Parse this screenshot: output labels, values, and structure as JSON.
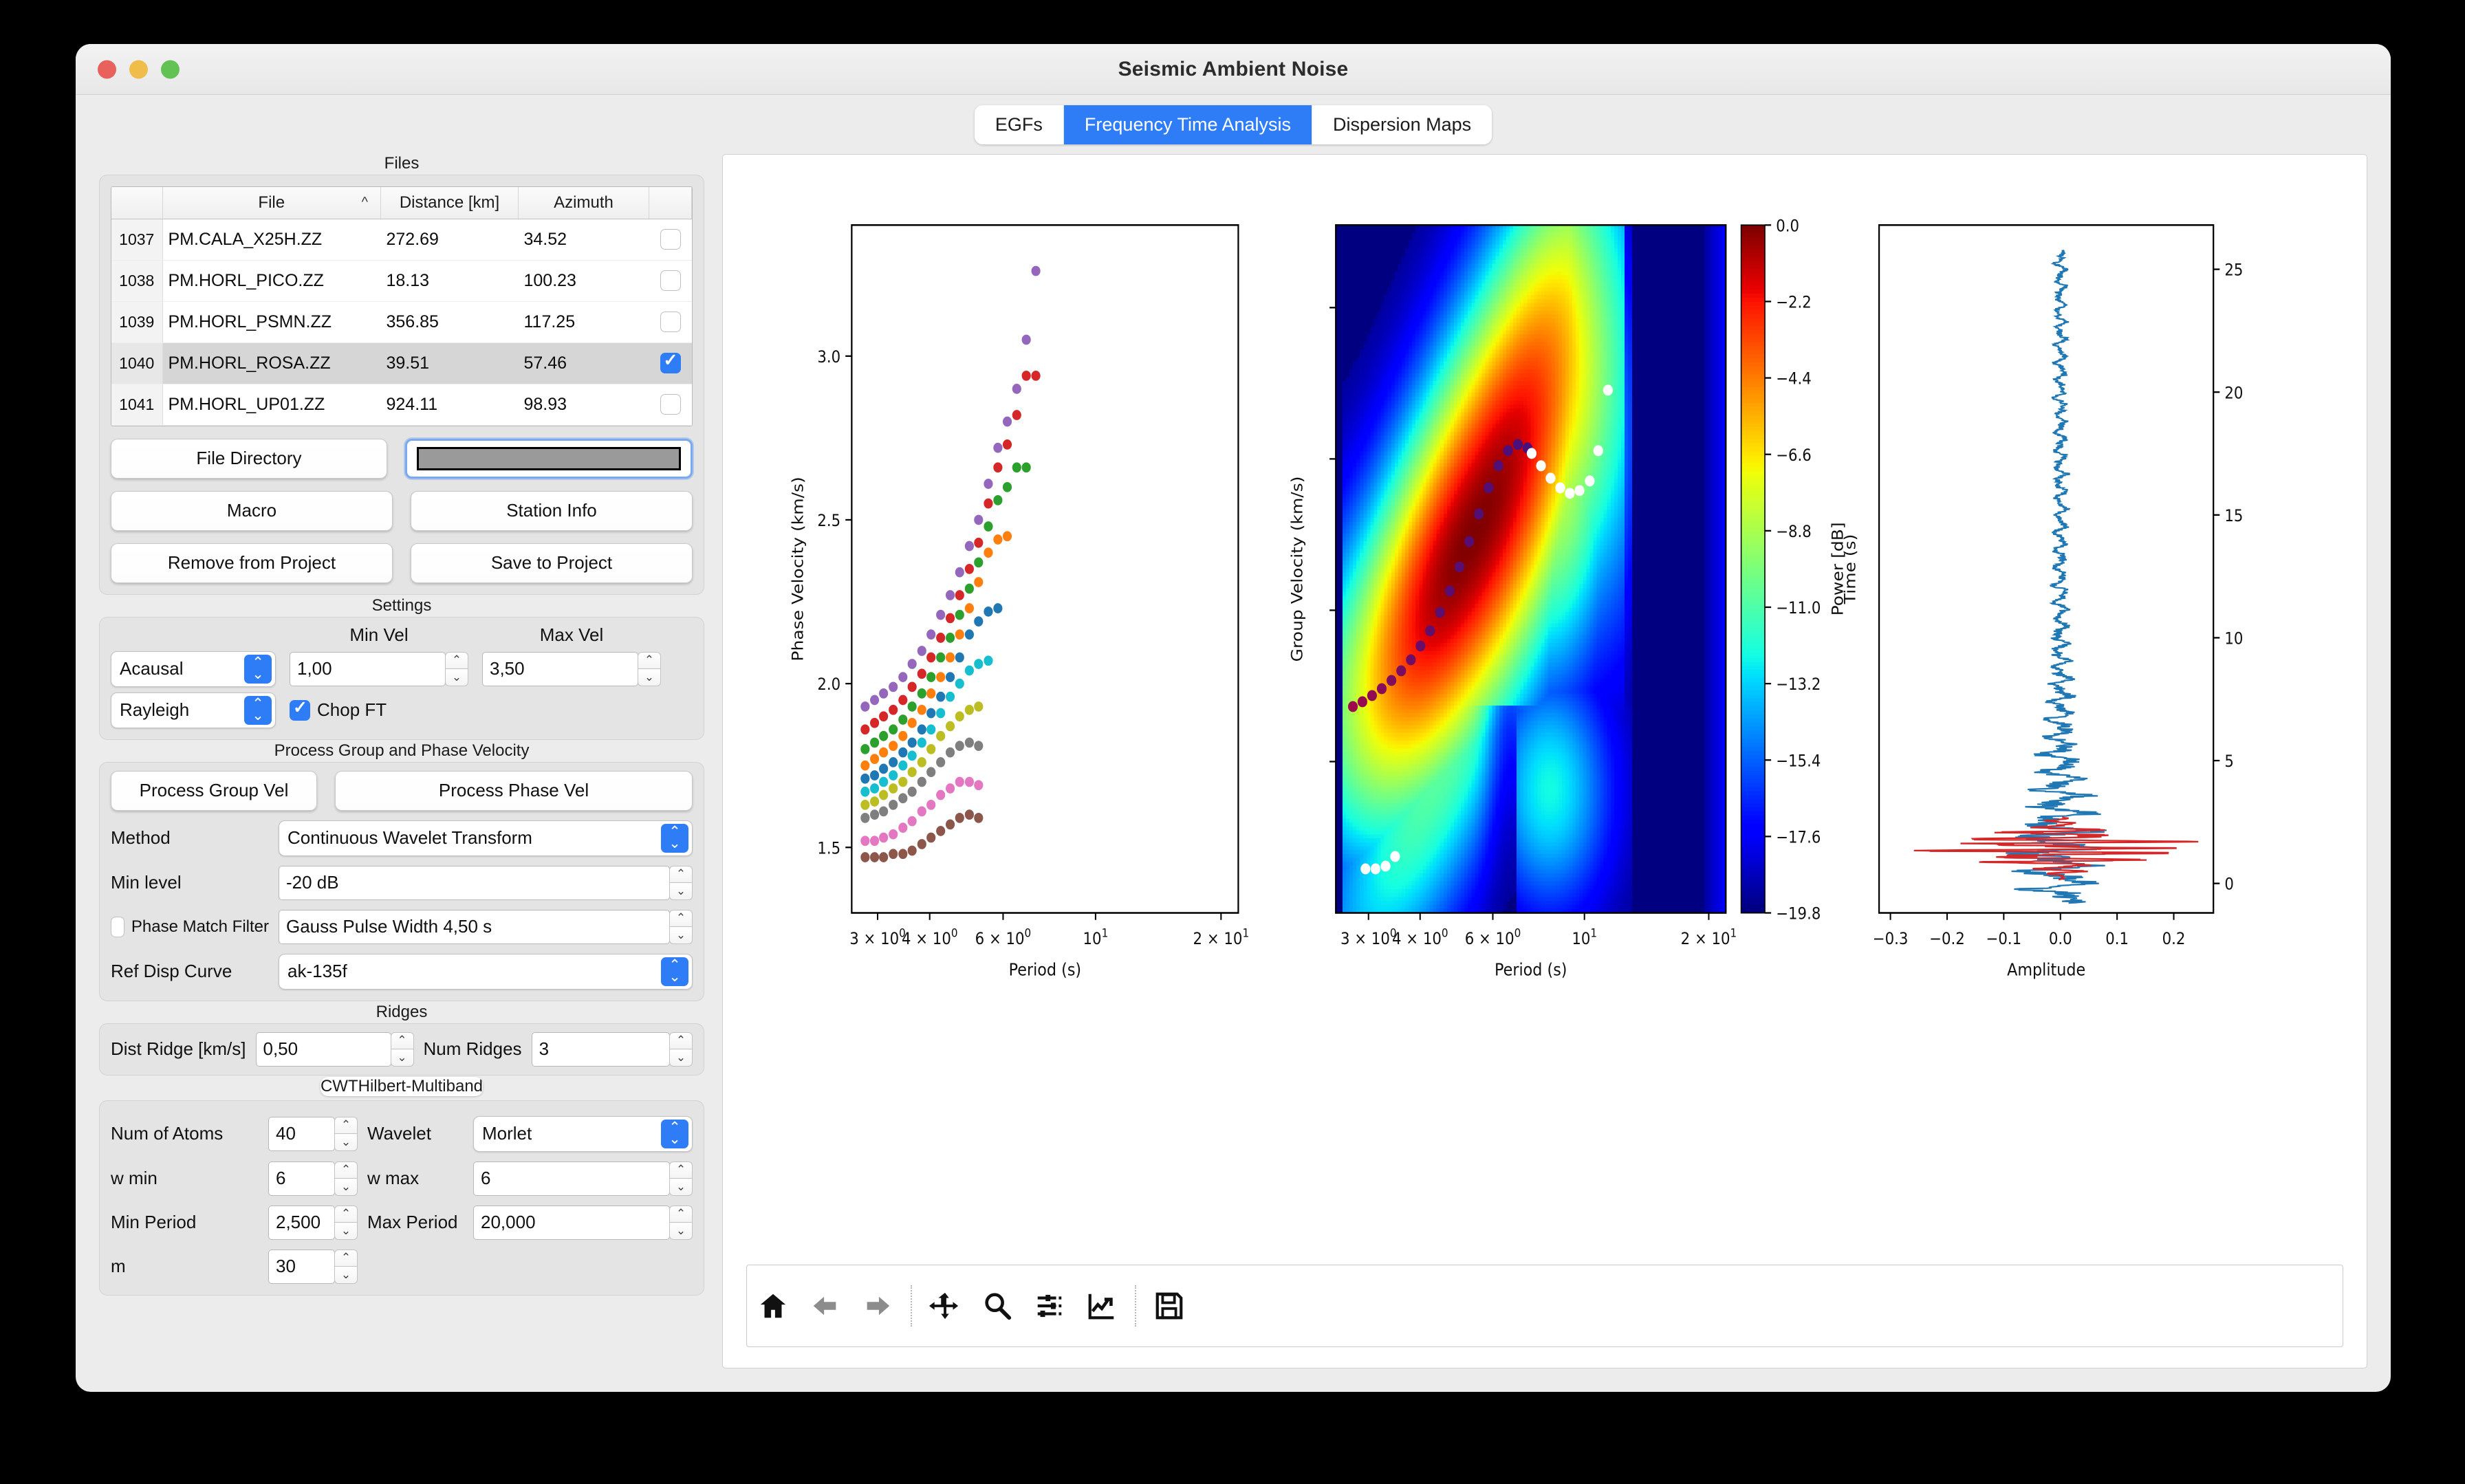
{
  "window": {
    "title": "Seismic Ambient Noise"
  },
  "tabs": [
    {
      "label": "EGFs",
      "active": false
    },
    {
      "label": "Frequency Time Analysis",
      "active": true
    },
    {
      "label": "Dispersion Maps",
      "active": false
    }
  ],
  "files_group": {
    "title": "Files",
    "columns": [
      "File",
      "Distance [km]",
      "Azimuth"
    ],
    "sort_indicator": "^",
    "rows": [
      {
        "index": "1037",
        "file": "PM.CALA_X25H.ZZ",
        "distance": "272.69",
        "azimuth": "34.52",
        "checked": false,
        "selected": false
      },
      {
        "index": "1038",
        "file": "PM.HORL_PICO.ZZ",
        "distance": "18.13",
        "azimuth": "100.23",
        "checked": false,
        "selected": false
      },
      {
        "index": "1039",
        "file": "PM.HORL_PSMN.ZZ",
        "distance": "356.85",
        "azimuth": "117.25",
        "checked": false,
        "selected": false
      },
      {
        "index": "1040",
        "file": "PM.HORL_ROSA.ZZ",
        "distance": "39.51",
        "azimuth": "57.46",
        "checked": true,
        "selected": true
      },
      {
        "index": "1041",
        "file": "PM.HORL_UP01.ZZ",
        "distance": "924.11",
        "azimuth": "98.93",
        "checked": false,
        "selected": false
      }
    ],
    "buttons": {
      "file_directory": "File Directory",
      "macro": "Macro",
      "remove_from_project": "Remove from Project",
      "station_info": "Station Info",
      "save_to_project": "Save to Project"
    }
  },
  "settings": {
    "title": "Settings",
    "min_vel_label": "Min Vel",
    "max_vel_label": "Max Vel",
    "causality": "Acausal",
    "wave_type": "Rayleigh",
    "min_vel": "1,00",
    "max_vel": "3,50",
    "chop_ft_label": "Chop FT",
    "chop_ft_checked": true
  },
  "process": {
    "title": "Process Group and Phase Velocity",
    "process_group_vel": "Process Group Vel",
    "process_phase_vel": "Process Phase Vel",
    "method_label": "Method",
    "method_value": "Continuous Wavelet Transform",
    "min_level_label": "Min level",
    "min_level_value": "-20 dB",
    "phase_match_filter_label": "Phase Match Filter",
    "phase_match_filter_checked": false,
    "gauss_pulse_value": "Gauss Pulse Width 4,50 s",
    "ref_disp_curve_label": "Ref Disp Curve",
    "ref_disp_curve_value": "ak-135f"
  },
  "ridges": {
    "title": "Ridges",
    "dist_ridge_label": "Dist Ridge [km/s]",
    "dist_ridge_value": "0,50",
    "num_ridges_label": "Num Ridges",
    "num_ridges_value": "3"
  },
  "cwt": {
    "tabs": [
      {
        "label": "CWT",
        "active": true
      },
      {
        "label": "Hilbert-Multiband",
        "active": false
      }
    ],
    "num_atoms_label": "Num of Atoms",
    "num_atoms_value": "40",
    "wavelet_label": "Wavelet",
    "wavelet_value": "Morlet",
    "w_min_label": "w min",
    "w_min_value": "6",
    "w_max_label": "w max",
    "w_max_value": "6",
    "min_period_label": "Min Period",
    "min_period_value": "2,500",
    "max_period_label": "Max Period",
    "max_period_value": "20,000",
    "m_label": "m",
    "m_value": "30"
  },
  "toolbar": {
    "buttons": [
      {
        "name": "home-icon",
        "tip": "Home"
      },
      {
        "name": "back-arrow-icon",
        "tip": "Back"
      },
      {
        "name": "forward-arrow-icon",
        "tip": "Forward"
      },
      {
        "name": "pan-icon",
        "tip": "Pan"
      },
      {
        "name": "zoom-icon",
        "tip": "Zoom"
      },
      {
        "name": "configure-subplots-icon",
        "tip": "Configure subplots"
      },
      {
        "name": "edit-axis-icon",
        "tip": "Edit axis"
      },
      {
        "name": "save-icon",
        "tip": "Save"
      }
    ]
  },
  "chart_data": [
    {
      "type": "scatter",
      "title": "",
      "xlabel": "Period (s)",
      "ylabel": "Phase Velocity (km/s)",
      "xscale": "log",
      "xlim": [
        2.6,
        22.0
      ],
      "ylim": [
        1.3,
        3.4
      ],
      "xticks": [
        "3 × 10⁰",
        "4 × 10⁰",
        "6 × 10⁰",
        "10¹",
        "2 × 10¹"
      ],
      "xtick_values": [
        3,
        4,
        6,
        10,
        20
      ],
      "yticks": [
        "1.5",
        "2.0",
        "2.5",
        "3.0"
      ],
      "ytick_values": [
        1.5,
        2.0,
        2.5,
        3.0
      ],
      "grid": false,
      "periods": [
        2.8,
        2.95,
        3.1,
        3.27,
        3.45,
        3.63,
        3.83,
        4.03,
        4.25,
        4.48,
        4.72,
        4.98,
        5.24,
        5.53,
        5.83,
        6.14,
        6.47,
        6.82,
        7.19
      ],
      "series": [
        {
          "name": "branch-10",
          "color": "#9467bd",
          "values": [
            1.93,
            1.95,
            1.97,
            1.99,
            2.02,
            2.06,
            2.1,
            2.15,
            2.21,
            2.27,
            2.34,
            2.42,
            2.5,
            2.61,
            2.72,
            2.8,
            2.9,
            3.05,
            3.26
          ]
        },
        {
          "name": "branch-9",
          "color": "#d62728",
          "values": [
            1.86,
            1.88,
            1.9,
            1.92,
            1.95,
            1.99,
            2.03,
            2.08,
            2.14,
            2.2,
            2.27,
            2.35,
            2.43,
            2.55,
            2.66,
            2.73,
            2.82,
            2.94,
            2.94
          ]
        },
        {
          "name": "branch-8",
          "color": "#2ca02c",
          "values": [
            1.8,
            1.82,
            1.84,
            1.86,
            1.89,
            1.93,
            1.97,
            2.02,
            2.08,
            2.14,
            2.21,
            2.29,
            2.37,
            2.48,
            2.56,
            2.6,
            2.66,
            2.66,
            null
          ]
        },
        {
          "name": "branch-7",
          "color": "#ff7f0e",
          "values": [
            1.75,
            1.77,
            1.79,
            1.81,
            1.84,
            1.88,
            1.92,
            1.97,
            2.02,
            2.08,
            2.15,
            2.23,
            2.31,
            2.4,
            2.44,
            2.45,
            null,
            null,
            null
          ]
        },
        {
          "name": "branch-6",
          "color": "#1f77b4",
          "values": [
            1.71,
            1.72,
            1.74,
            1.76,
            1.79,
            1.82,
            1.86,
            1.91,
            1.96,
            2.02,
            2.08,
            2.15,
            2.19,
            2.22,
            2.23,
            null,
            null,
            null,
            null
          ]
        },
        {
          "name": "branch-5",
          "color": "#17becf",
          "values": [
            1.67,
            1.68,
            1.7,
            1.72,
            1.75,
            1.78,
            1.82,
            1.86,
            1.91,
            1.96,
            2.0,
            2.04,
            2.06,
            2.07,
            null,
            null,
            null,
            null,
            null
          ]
        },
        {
          "name": "branch-4",
          "color": "#bcbd22",
          "values": [
            1.63,
            1.64,
            1.66,
            1.68,
            1.7,
            1.73,
            1.76,
            1.8,
            1.84,
            1.87,
            1.9,
            1.92,
            1.93,
            null,
            null,
            null,
            null,
            null,
            null
          ]
        },
        {
          "name": "branch-3",
          "color": "#7f7f7f",
          "values": [
            1.59,
            1.6,
            1.61,
            1.63,
            1.65,
            1.67,
            1.7,
            1.73,
            1.76,
            1.79,
            1.81,
            1.82,
            1.81,
            null,
            null,
            null,
            null,
            null,
            null
          ]
        },
        {
          "name": "branch-2",
          "color": "#e377c2",
          "values": [
            1.52,
            1.52,
            1.53,
            1.54,
            1.56,
            1.58,
            1.61,
            1.63,
            1.66,
            1.68,
            1.7,
            1.7,
            1.69,
            null,
            null,
            null,
            null,
            null,
            null
          ]
        },
        {
          "name": "branch-1",
          "color": "#8c564b",
          "values": [
            1.47,
            1.47,
            1.47,
            1.48,
            1.48,
            1.49,
            1.51,
            1.53,
            1.55,
            1.57,
            1.59,
            1.6,
            1.59,
            null,
            null,
            null,
            null,
            null,
            null
          ]
        }
      ]
    },
    {
      "type": "heatmap",
      "title": "",
      "xlabel": "Period (s)",
      "ylabel": "Group Velocity (km/s)",
      "xscale": "log",
      "xlim": [
        2.5,
        22.0
      ],
      "xticks": [
        "3 × 10⁰",
        "4 × 10⁰",
        "6 × 10⁰",
        "10¹",
        "2 × 10¹"
      ],
      "xtick_values": [
        3,
        4,
        6,
        10,
        20
      ],
      "colormap": "jet",
      "colorbar": {
        "label": "Power [dB]",
        "ticks": [
          "0.0",
          "−2.2",
          "−4.4",
          "−6.6",
          "−8.8",
          "−11.0",
          "−13.2",
          "−15.4",
          "−17.6",
          "−19.8"
        ],
        "tick_values": [
          0.0,
          -2.2,
          -4.4,
          -6.6,
          -8.8,
          -11.0,
          -13.2,
          -15.4,
          -17.6,
          -19.8
        ],
        "vmin": -19.8,
        "vmax": 0.0
      },
      "ridge_primary": {
        "name": "ridge-1",
        "color_start": "#9e0b4d",
        "color_end": "#4b0f7a",
        "points": [
          [
            2.75,
            0.3
          ],
          [
            2.9,
            0.307
          ],
          [
            3.06,
            0.316
          ],
          [
            3.23,
            0.326
          ],
          [
            3.41,
            0.338
          ],
          [
            3.6,
            0.352
          ],
          [
            3.8,
            0.368
          ],
          [
            4.01,
            0.388
          ],
          [
            4.23,
            0.41
          ],
          [
            4.47,
            0.437
          ],
          [
            4.72,
            0.468
          ],
          [
            4.98,
            0.503
          ],
          [
            5.26,
            0.54
          ],
          [
            5.55,
            0.58
          ],
          [
            5.86,
            0.618
          ],
          [
            6.19,
            0.65
          ],
          [
            6.53,
            0.672
          ],
          [
            6.9,
            0.681
          ],
          [
            7.28,
            0.676
          ]
        ]
      },
      "ridge_secondary": {
        "name": "ridge-2",
        "color": "#ffffff",
        "points": [
          [
            7.45,
            0.668
          ],
          [
            7.85,
            0.65
          ],
          [
            8.28,
            0.632
          ],
          [
            8.74,
            0.618
          ],
          [
            9.22,
            0.61
          ],
          [
            9.73,
            0.614
          ],
          [
            10.3,
            0.628
          ],
          [
            10.8,
            0.672
          ],
          [
            11.4,
            0.76
          ]
        ]
      },
      "ridge_tertiary": {
        "name": "ridge-3",
        "color": "#ffffff",
        "points": [
          [
            2.95,
            0.064
          ],
          [
            3.12,
            0.064
          ],
          [
            3.3,
            0.068
          ],
          [
            3.48,
            0.082
          ]
        ]
      }
    },
    {
      "type": "line",
      "title": "",
      "xlabel": "Amplitude",
      "ylabel": "Time (s)",
      "xlim": [
        -0.32,
        0.27
      ],
      "ylim": [
        -1.2,
        26.8
      ],
      "xticks": [
        "−0.3",
        "−0.2",
        "−0.1",
        "0.0",
        "0.1",
        "0.2"
      ],
      "xtick_values": [
        -0.3,
        -0.2,
        -0.1,
        0.0,
        0.1,
        0.2
      ],
      "yticks": [
        "0",
        "5",
        "10",
        "15",
        "20",
        "25"
      ],
      "ytick_values": [
        0,
        5,
        10,
        15,
        20,
        25
      ],
      "series": [
        {
          "name": "waveform",
          "color": "#1f77b4"
        },
        {
          "name": "windowed-signal",
          "color": "#d62728"
        }
      ]
    }
  ]
}
